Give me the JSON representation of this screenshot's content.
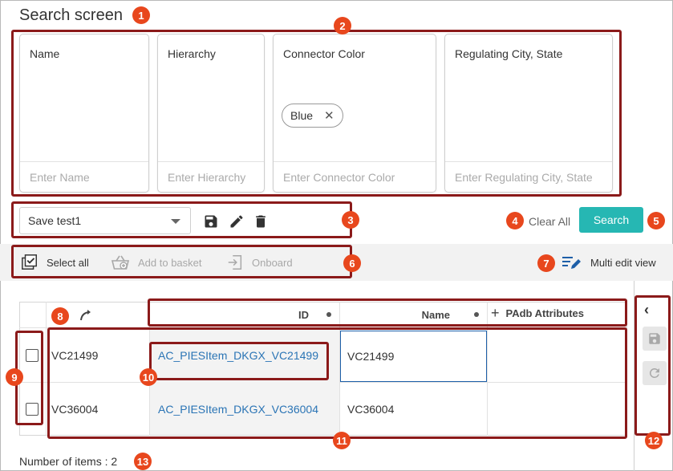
{
  "page": {
    "title": "Search screen"
  },
  "badges": [
    "1",
    "2",
    "3",
    "4",
    "5",
    "6",
    "7",
    "8",
    "9",
    "10",
    "11",
    "12",
    "13"
  ],
  "fields": [
    {
      "label": "Name",
      "placeholder": "Enter Name"
    },
    {
      "label": "Hierarchy",
      "placeholder": "Enter Hierarchy"
    },
    {
      "label": "Connector Color",
      "placeholder": "Enter Connector Color",
      "chips": [
        "Blue"
      ]
    },
    {
      "label": "Regulating City, State",
      "placeholder": "Enter Regulating City, State"
    }
  ],
  "saved_search": {
    "selected": "Save test1",
    "icons": [
      "save-icon",
      "edit-icon",
      "delete-icon"
    ]
  },
  "actions": {
    "clear_all": "Clear All",
    "search": "Search"
  },
  "toolbar": {
    "select_all": "Select all",
    "add_to_basket": "Add to basket",
    "onboard": "Onboard",
    "multi_edit": "Multi edit view"
  },
  "grid": {
    "columns": {
      "id": "ID",
      "name": "Name",
      "padb": "PAdb Attributes",
      "add_symbol": "+"
    },
    "rows": [
      {
        "key": "VC21499",
        "id": "AC_PIESItem_DKGX_VC21499",
        "name": "VC21499"
      },
      {
        "key": "VC36004",
        "id": "AC_PIESItem_DKGX_VC36004",
        "name": "VC36004"
      }
    ]
  },
  "footer": {
    "count": "Number of items : 2"
  },
  "colors": {
    "accent": "#26b7b3",
    "badge": "#e8471d",
    "highlight": "#8b1a1a",
    "link": "#2a74b5"
  }
}
